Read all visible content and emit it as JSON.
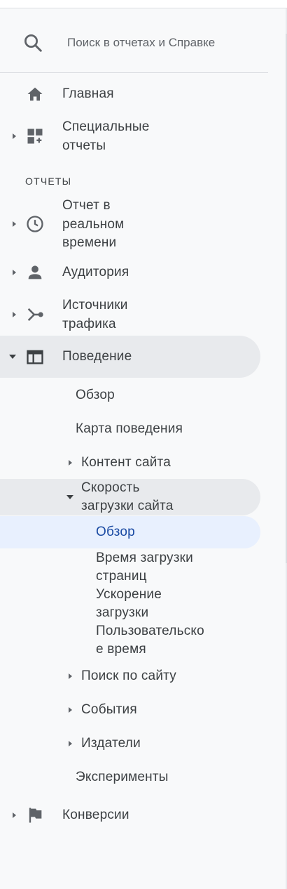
{
  "search": {
    "placeholder": "Поиск в отчетах и Справке"
  },
  "nav": {
    "home": "Главная",
    "custom_reports": [
      "Специальные",
      "отчеты"
    ],
    "section_reports": "ОТЧЕТЫ",
    "realtime": [
      "Отчет в",
      "реальном",
      "времени"
    ],
    "audience": "Аудитория",
    "acquisition": [
      "Источники",
      "трафика"
    ],
    "behavior": "Поведение",
    "behavior_items": {
      "overview": "Обзор",
      "behavior_flow": "Карта поведения",
      "site_content": "Контент сайта",
      "site_speed": [
        "Скорость",
        "загрузки сайта"
      ],
      "site_speed_items": {
        "overview": "Обзор",
        "page_timings": [
          "Время загрузки",
          "страниц"
        ],
        "speed_suggestions": [
          "Ускорение",
          "загрузки"
        ],
        "user_timings": [
          "Пользовательско",
          "е время"
        ]
      },
      "site_search": "Поиск по сайту",
      "events": "События",
      "publisher": "Издатели",
      "experiments": "Эксперименты"
    },
    "conversions": "Конверсии"
  },
  "colors": {
    "active_bg": "#e8f0fe",
    "active_text": "#1a4aa3",
    "hover_bg": "#e8eaed"
  }
}
